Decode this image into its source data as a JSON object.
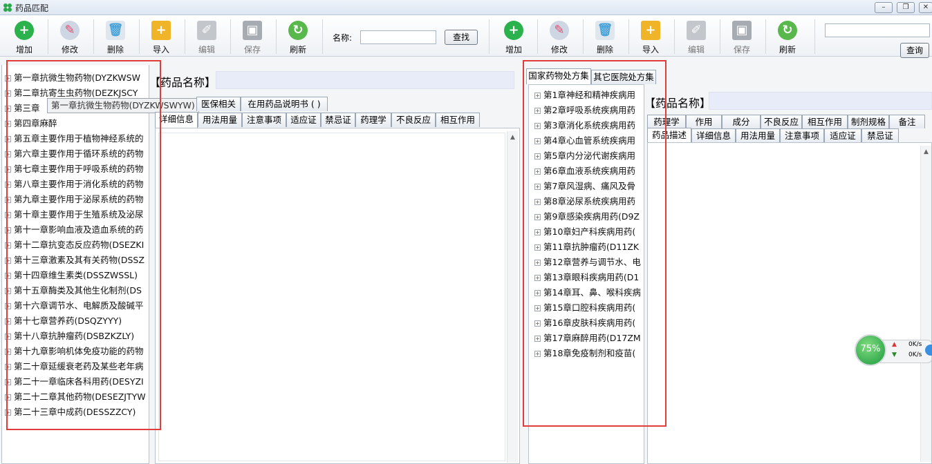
{
  "window": {
    "title": "药品匹配",
    "controls": [
      "minimize",
      "restore",
      "close"
    ]
  },
  "toolbar_left": {
    "buttons": [
      {
        "label": "增加",
        "icon": "add-icon",
        "color": "#2bb24c",
        "enabled": true
      },
      {
        "label": "修改",
        "icon": "edit-icon",
        "color": "#e94b6c",
        "enabled": true
      },
      {
        "label": "删除",
        "icon": "trash-icon",
        "color": "#4aa3d8",
        "enabled": true
      },
      {
        "label": "导入",
        "icon": "import-folder-icon",
        "color": "#f0b428",
        "enabled": true
      },
      {
        "label": "编辑",
        "icon": "pencil-icon",
        "color": "#9aa0a8",
        "enabled": false
      },
      {
        "label": "保存",
        "icon": "save-icon",
        "color": "#9aa0a8",
        "enabled": false
      },
      {
        "label": "刷新",
        "icon": "refresh-icon",
        "color": "#59b84c",
        "enabled": true
      }
    ],
    "search_label": "名称:",
    "search_value": "",
    "find_button": "查找"
  },
  "toolbar_right": {
    "buttons": [
      {
        "label": "增加",
        "icon": "add-icon",
        "color": "#2bb24c",
        "enabled": true
      },
      {
        "label": "修改",
        "icon": "edit-icon",
        "color": "#e94b6c",
        "enabled": true
      },
      {
        "label": "删除",
        "icon": "trash-icon",
        "color": "#4aa3d8",
        "enabled": true
      },
      {
        "label": "导入",
        "icon": "import-folder-icon",
        "color": "#f0b428",
        "enabled": true
      },
      {
        "label": "编辑",
        "icon": "pencil-icon",
        "color": "#9aa0a8",
        "enabled": false
      },
      {
        "label": "保存",
        "icon": "save-icon",
        "color": "#9aa0a8",
        "enabled": false
      },
      {
        "label": "刷新",
        "icon": "refresh-icon",
        "color": "#59b84c",
        "enabled": true
      }
    ],
    "search_value": "",
    "query_button": "查询"
  },
  "left_tree": {
    "items": [
      "第一章抗微生物药物(DYZKWSW",
      "第二章抗寄生虫药物(DEZKJSCY",
      "第三章",
      "第四章麻醉",
      "第五章主要作用于植物神经系统的",
      "第六章主要作用于循环系统的药物",
      "第七章主要作用于呼吸系统的药物",
      "第八章主要作用于消化系统的药物",
      "第九章主要作用于泌尿系统的药物",
      "第十章主要作用于生殖系统及泌尿",
      "第十一章影响血液及造血系统的药",
      "第十二章抗变态反应药物(DSEZKI",
      "第十三章激素及其有关药物(DSSZ",
      "第十四章维生素类(DSSZWSSL)",
      "第十五章酶类及其他生化制剂(DS",
      "第十六章调节水、电解质及酸碱平",
      "第十七章营养药(DSQZYYY)",
      "第十八章抗肿瘤药(DSBZKZLY)",
      "第十九章影响机体免疫功能的药物",
      "第二十章延缓衰老药及某些老年病",
      "第二十一章临床各科用药(DESYZI",
      "第二十二章其他药物(DESEZJTYW",
      "第二十三章中成药(DESSZZCY)"
    ],
    "tooltip": "第一章抗微生物药物(DYZKWSWYW)"
  },
  "middle_panel": {
    "name_label": "【药品名称】",
    "name_value": "",
    "tabs_row1": [
      "医保相关",
      "在用药品说明书 ( )"
    ],
    "tabs_row2": [
      "详细信息",
      "用法用量",
      "注意事项",
      "适应证",
      "禁忌证",
      "药理学",
      "不良反应",
      "相互作用"
    ],
    "selected_tab": "详细信息"
  },
  "right_tree": {
    "tabs": [
      "国家药物处方集",
      "其它医院处方集"
    ],
    "selected_tab": "国家药物处方集",
    "items": [
      "第1章神经和精神疾病用",
      "第2章呼吸系统疾病用药",
      "第3章消化系统疾病用药",
      "第4章心血管系统疾病用",
      "第5章内分泌代谢疾病用",
      "第6章血液系统疾病用药",
      "第7章风湿病、痛风及骨",
      "第8章泌尿系统疾病用药",
      "第9章感染疾病用药(D9Z",
      "第10章妇产科疾病用药(",
      "第11章抗肿瘤药(D11ZK",
      "第12章营养与调节水、电",
      "第13章眼科疾病用药(D1",
      "第14章耳、鼻、喉科疾病",
      "第15章口腔科疾病用药(",
      "第16章皮肤科疾病用药(",
      "第17章麻醉用药(D17ZM",
      "第18章免疫制剂和疫苗("
    ]
  },
  "far_right_panel": {
    "name_label": "【药品名称】",
    "name_value": "",
    "tabs_row1": [
      "药理学",
      "作用",
      "成分",
      "不良反应",
      "相互作用",
      "制剂规格",
      "备注"
    ],
    "tabs_row2": [
      "药品描述",
      "详细信息",
      "用法用量",
      "注意事项",
      "适应证",
      "禁忌证"
    ],
    "selected_tab": "药品描述"
  },
  "net_widget": {
    "percent": "75%",
    "up": "0K/s",
    "down": "0K/s"
  },
  "accent_colors": {
    "highlight_box": "#e03c3c",
    "name_field": "#e8ebf8"
  }
}
